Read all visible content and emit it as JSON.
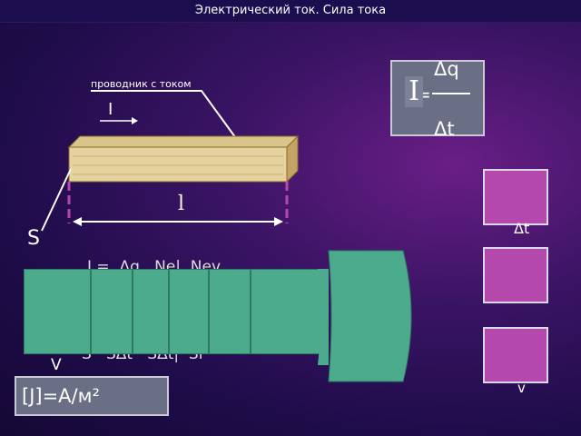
{
  "window": {
    "title": "Электрический ток. Сила тока"
  },
  "diagram": {
    "conductor_label": "проводник с током",
    "current_label": "I",
    "length_label": "l",
    "area_label": "S"
  },
  "formula": {
    "I": "I",
    "eq": "=",
    "dq": "Δq",
    "dt": "Δt"
  },
  "side_labels": {
    "dt": "Δt",
    "v": "v"
  },
  "occluded_formula": {
    "top": "J =  Δq   Ne|  Nev",
    "bottom": "S   SΔt   SΔt|  Sl",
    "v": "V"
  },
  "unit": "[J]=A/м²",
  "colors": {
    "accent_purple": "#b448ad",
    "green": "#4cab8d",
    "box_gray": "#6a6f86"
  }
}
